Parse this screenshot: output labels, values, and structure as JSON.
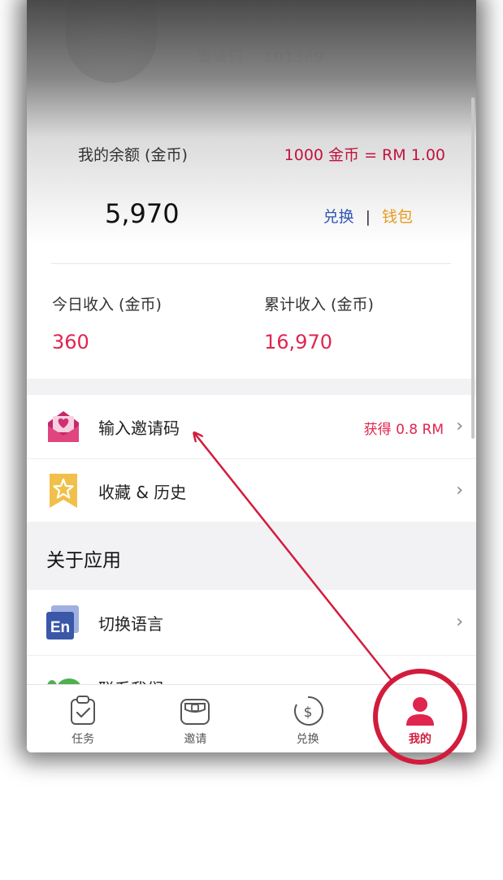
{
  "profile": {
    "invite_label": "邀请码",
    "invite_code": "101389"
  },
  "balance": {
    "label": "我的余额 (金币)",
    "rate_coins": "1000 金币",
    "rate_rm": "= RM 1.00",
    "value": "5,970",
    "exchange_label": "兑换",
    "separator": "|",
    "wallet_label": "钱包"
  },
  "stats": {
    "today_label": "今日收入 (金币)",
    "today_value": "360",
    "total_label": "累计收入 (金币)",
    "total_value": "16,970"
  },
  "menu": {
    "invite_code_label": "输入邀请码",
    "invite_reward": "获得 0.8 RM",
    "favorites_label": "收藏 & 历史",
    "section_about": "关于应用",
    "language_label": "切换语言",
    "language_icon_text": "En",
    "contact_label": "联系我们"
  },
  "nav": {
    "tasks": "任务",
    "invite": "邀请",
    "exchange": "兑换",
    "mine": "我的"
  },
  "colors": {
    "accent_red": "#e0254f",
    "annotation_red": "#d21c3c",
    "exchange_blue": "#2f56b3",
    "wallet_orange": "#e79a1d"
  },
  "icons": {
    "invite_row": "heart-envelope-icon",
    "favorites_row": "star-bookmark-icon",
    "language_row": "en-language-icon",
    "contact_row": "chat-icon",
    "nav_tasks": "clipboard-check-icon",
    "nav_invite": "gift-box-icon",
    "nav_exchange": "dollar-coin-icon",
    "nav_mine": "user-icon"
  }
}
